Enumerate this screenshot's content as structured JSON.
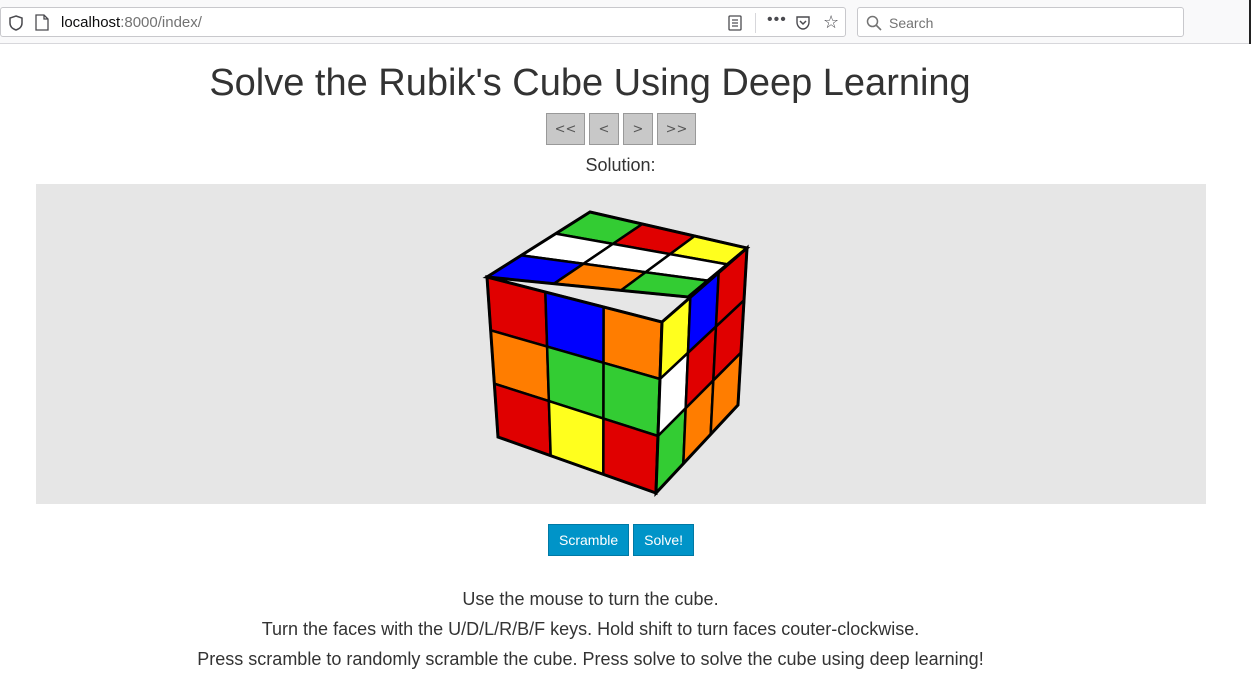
{
  "browser": {
    "url_host": "localhost",
    "url_rest": ":8000/index/",
    "search_placeholder": "Search",
    "more_label": "•••",
    "star_label": "☆"
  },
  "page": {
    "title": "Solve the Rubik's Cube Using Deep Learning",
    "nav": {
      "first_label": "<<",
      "prev_label": "<",
      "next_label": ">",
      "last_label": ">>"
    },
    "solution_label": "Solution:",
    "scramble_label": "Scramble",
    "solve_label": "Solve!",
    "instructions": [
      "Use the mouse to turn the cube.",
      "Turn the faces with the U/D/L/R/B/F keys. Hold shift to turn faces couter-clockwise.",
      "Press scramble to randomly scramble the cube. Press solve to solve the cube using deep learning!"
    ]
  },
  "cube": {
    "colors": {
      "R": "#e00000",
      "O": "#ff7d00",
      "Y": "#ffff1e",
      "G": "#33cc33",
      "B": "#0000ff",
      "W": "#ffffff"
    },
    "top_face": [
      [
        "B",
        "W",
        "G"
      ],
      [
        "O",
        "W",
        "R"
      ],
      [
        "G",
        "W",
        "Y"
      ]
    ],
    "front_face": [
      [
        "R",
        "B",
        "O"
      ],
      [
        "O",
        "G",
        "G"
      ],
      [
        "R",
        "Y",
        "R"
      ]
    ],
    "right_face": [
      [
        "Y",
        "B",
        "R"
      ],
      [
        "W",
        "R",
        "R"
      ],
      [
        "G",
        "O",
        "O"
      ]
    ]
  }
}
